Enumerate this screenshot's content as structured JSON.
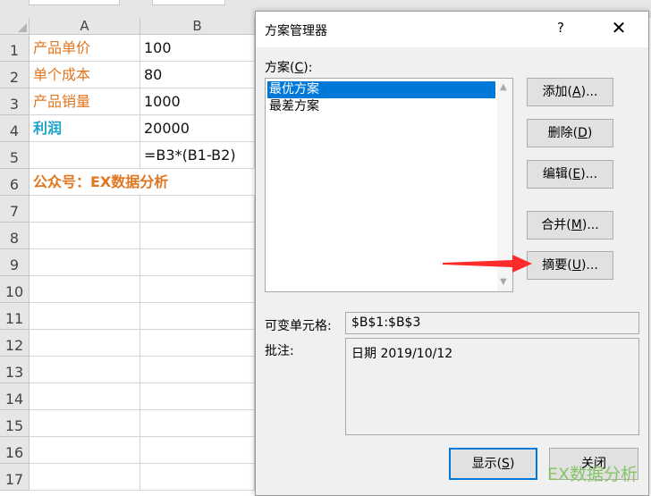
{
  "sheet": {
    "columns": [
      "A",
      "B"
    ],
    "rows": [
      "1",
      "2",
      "3",
      "4",
      "5",
      "6",
      "7",
      "8",
      "9",
      "10",
      "11",
      "12",
      "13",
      "14",
      "15",
      "16",
      "17"
    ],
    "cells": {
      "a1": "产品单价",
      "b1": "100",
      "a2": "单个成本",
      "b2": "80",
      "a3": "产品销量",
      "b3": "1000",
      "a4": "利润",
      "b4": "20000",
      "b5": "=B3*(B1-B2)",
      "a6": "公众号：EX数据分析"
    }
  },
  "dialog": {
    "title": "方案管理器",
    "help": "?",
    "close": "✕",
    "scenarios_label_prefix": "方案(",
    "scenarios_label_key": "C",
    "scenarios_label_suffix": "):",
    "scenarios": [
      "最优方案",
      "最差方案"
    ],
    "buttons": {
      "add": {
        "prefix": "添加(",
        "key": "A",
        "suffix": ")..."
      },
      "delete": {
        "prefix": "删除(",
        "key": "D",
        "suffix": ")"
      },
      "edit": {
        "prefix": "编辑(",
        "key": "E",
        "suffix": ")..."
      },
      "merge": {
        "prefix": "合并(",
        "key": "M",
        "suffix": ")..."
      },
      "summary": {
        "prefix": "摘要(",
        "key": "U",
        "suffix": ")..."
      },
      "show": {
        "prefix": "显示(",
        "key": "S",
        "suffix": ")"
      },
      "close": "关闭"
    },
    "changing_cells_label": "可变单元格:",
    "changing_cells_value": "$B$1:$B$3",
    "comment_label": "批注:",
    "comment_value": "日期 2019/10/12"
  },
  "watermark": "EX数据分析",
  "colors": {
    "accent": "#0078d7",
    "orange": "#e0761f",
    "teal": "#1aa3c8",
    "arrow": "#ff2a2a"
  }
}
